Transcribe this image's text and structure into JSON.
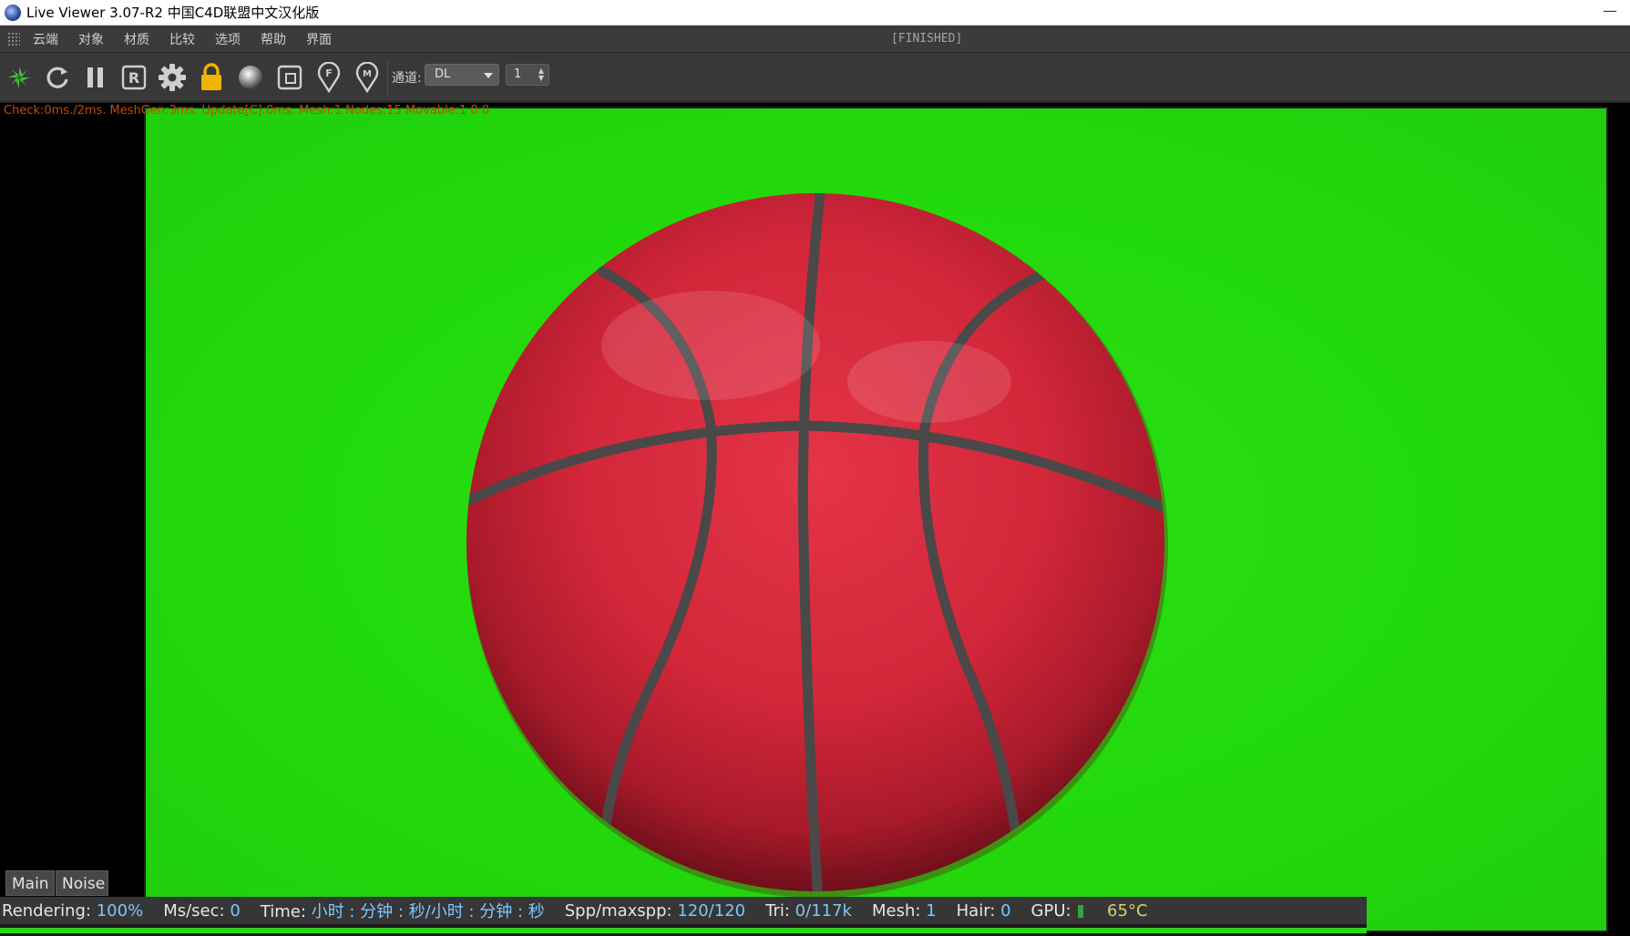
{
  "window": {
    "title": "Live Viewer 3.07-R2 中国C4D联盟中文汉化版",
    "minimize_glyph": "—"
  },
  "menubar": {
    "items": [
      "云端",
      "对象",
      "材质",
      "比较",
      "选项",
      "帮助",
      "界面"
    ],
    "status": "[FINISHED]"
  },
  "toolbar": {
    "buttons": [
      {
        "name": "render-start-icon",
        "color": "#3fbf3f"
      },
      {
        "name": "refresh-icon"
      },
      {
        "name": "pause-icon"
      },
      {
        "name": "region-render-icon",
        "label": "R"
      },
      {
        "name": "settings-gear-icon"
      },
      {
        "name": "lock-icon",
        "color": "#f0b400"
      },
      {
        "name": "material-sphere-icon"
      },
      {
        "name": "crop-frame-icon"
      },
      {
        "name": "focus-pick-icon",
        "label": "F"
      },
      {
        "name": "material-pick-icon",
        "label": "M"
      }
    ],
    "channel_label": "通道:",
    "channel_value": "DL",
    "spinner_value": "1"
  },
  "viewport": {
    "debug_text": "Check:0ms./2ms. MeshGen:3ms. Update[C]:0ms. Mesh:1 Nodes:15 Movable:1 0 0",
    "background_color": "#22d90d",
    "ball_color": "#d8283a"
  },
  "tabs": {
    "main": "Main",
    "noise": "Noise"
  },
  "status": {
    "rendering_label": "Rendering:",
    "rendering_value": "100%",
    "mssec_label": "Ms/sec:",
    "mssec_value": "0",
    "time_label": "Time:",
    "time_value": "小时 : 分钟 : 秒/小时 : 分钟 : 秒",
    "spp_label": "Spp/maxspp:",
    "spp_value": "120/120",
    "tri_label": "Tri:",
    "tri_value": "0/117k",
    "mesh_label": "Mesh:",
    "mesh_value": "1",
    "hair_label": "Hair:",
    "hair_value": "0",
    "gpu_label": "GPU:",
    "gpu_temp": "65°C"
  }
}
